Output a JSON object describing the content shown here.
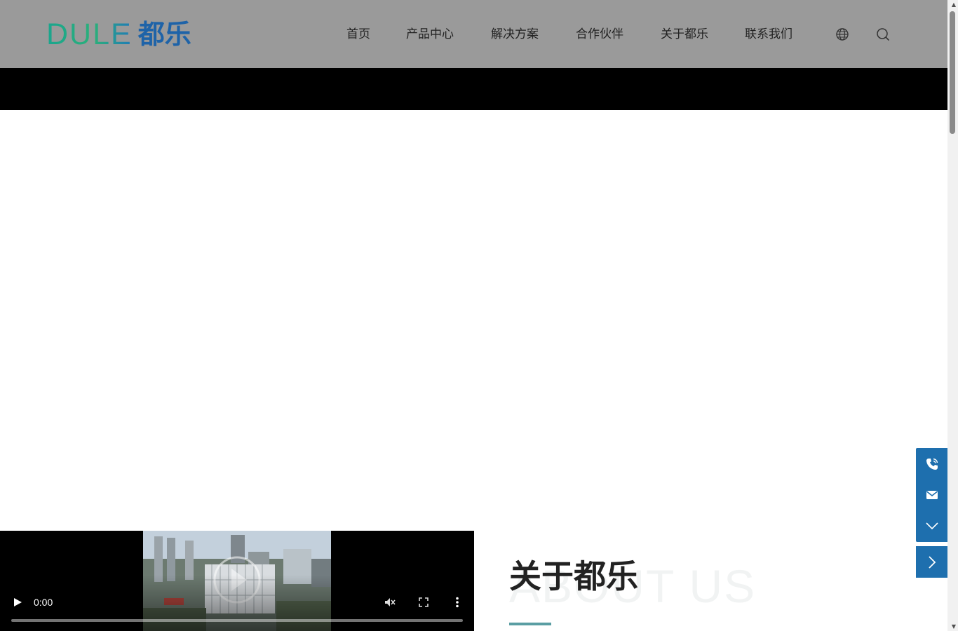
{
  "logo": {
    "latin": "DULE",
    "cn": "都乐"
  },
  "nav": {
    "items": [
      "首页",
      "产品中心",
      "解决方案",
      "合作伙伴",
      "关于都乐",
      "联系我们"
    ]
  },
  "header_icons": [
    "globe-icon",
    "search-icon"
  ],
  "side_buttons": [
    "phone-icon",
    "mail-icon",
    "chevron-down-icon",
    "chevron-right-icon"
  ],
  "video": {
    "time": "0:00"
  },
  "about": {
    "title": "关于都乐",
    "subtitle": "ABOUT US"
  },
  "colors": {
    "header": "#9a9a9a",
    "accent": "#1e6fae",
    "brand_blue": "#1e63a8",
    "brand_green": "#1aa58e",
    "divider": "#5a9ea3"
  }
}
